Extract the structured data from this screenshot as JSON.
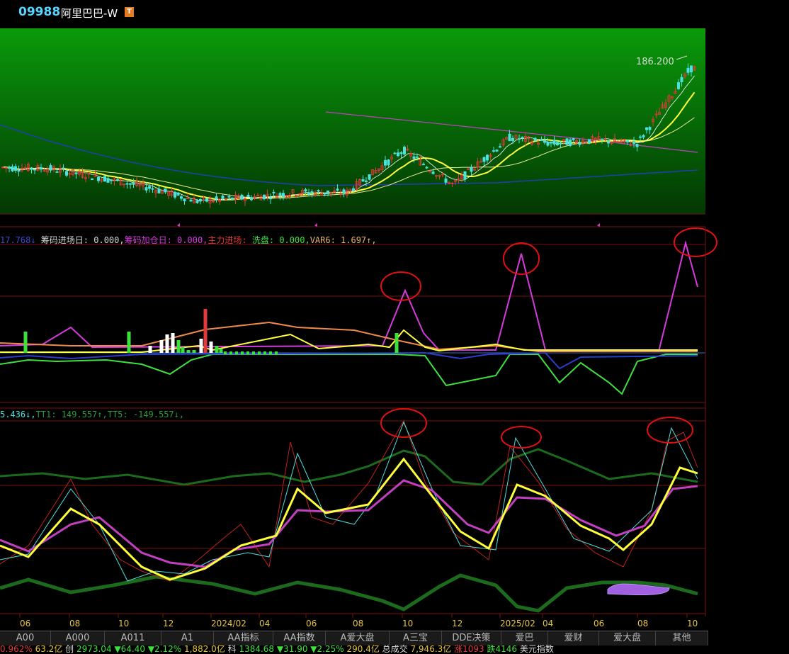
{
  "header": {
    "code": "09988",
    "name": "阿里巴巴-W",
    "badge": "T"
  },
  "price_label": "186.200",
  "legend1": [
    {
      "text": "17.768↓",
      "color": "#3b4ccf"
    },
    {
      "text": " 筹码进场日: 0.000,",
      "color": "#d8d8d8"
    },
    {
      "text": "筹码加仓日: 0.000,",
      "color": "#d63adf"
    },
    {
      "text": "主力进场:",
      "color": "#e23a3a"
    },
    {
      "text": " 洗盘: 0.000,",
      "color": "#3ee03e"
    },
    {
      "text": "VAR6: 1.697↑,",
      "color": "#e8b56a"
    }
  ],
  "legend2": [
    {
      "text": "5.436↓,",
      "color": "#4de0e0"
    },
    {
      "text": "TT1: 149.557↑,",
      "color": "#2f9a3a"
    },
    {
      "text": "TT5: -149.557↓,",
      "color": "#2f9a3a"
    }
  ],
  "dates": [
    "06",
    "08",
    "10",
    "12",
    "2024/02",
    "04",
    "06",
    "08",
    "10",
    "12",
    "2025/02",
    "04",
    "06",
    "08",
    "10"
  ],
  "tabs": [
    "A00",
    "A000",
    "A011",
    "A1",
    "AA指标",
    "AA指数",
    "A爱大盘",
    "A三宝",
    "DDE决策",
    "爱巴",
    "爱财",
    "爱大盘",
    "其他"
  ],
  "status": [
    {
      "text": "0.962% ",
      "color": "#e23a3a"
    },
    {
      "text": "63.2亿 ",
      "color": "#e4c637"
    },
    {
      "text": "创",
      "color": "#ddd"
    },
    {
      "text": " 2973.04 ",
      "color": "#3ee03e"
    },
    {
      "text": "▼64.40 ",
      "color": "#3ee03e"
    },
    {
      "text": "▼2.12% ",
      "color": "#3ee03e"
    },
    {
      "text": "1,882.0亿 ",
      "color": "#e4c637"
    },
    {
      "text": "科",
      "color": "#ddd"
    },
    {
      "text": " 1384.68 ",
      "color": "#3ee03e"
    },
    {
      "text": "▼31.90 ",
      "color": "#3ee03e"
    },
    {
      "text": "▼2.25% ",
      "color": "#3ee03e"
    },
    {
      "text": "290.4亿 ",
      "color": "#e4c637"
    },
    {
      "text": "总成交 ",
      "color": "#ddd"
    },
    {
      "text": "7,946.3亿 ",
      "color": "#e4c637"
    },
    {
      "text": "涨1093 ",
      "color": "#e23a3a"
    },
    {
      "text": "跌4146 ",
      "color": "#3ee03e"
    },
    {
      "text": "美元指数",
      "color": "#ddd"
    }
  ],
  "colors": {
    "up": "#e23a3a",
    "down": "#4de0e0",
    "ma5": "#ffffff",
    "ma10": "#ffff3a",
    "ma60": "#c040c0",
    "ma250": "#1f3fb0"
  },
  "chart_data": [
    {
      "type": "candlestick",
      "title": "09988 阿里巴巴-W",
      "x": [
        "2023/06",
        "2023/08",
        "2023/10",
        "2023/12",
        "2024/02",
        "2024/04",
        "2024/06",
        "2024/08",
        "2024/10",
        "2024/12",
        "2025/02",
        "2025/04",
        "2025/06",
        "2025/08",
        "2025/10"
      ],
      "series": [
        {
          "name": "close",
          "values": [
            96,
            95,
            88,
            80,
            69,
            72,
            76,
            76,
            110,
            82,
            120,
            115,
            118,
            115,
            175
          ]
        }
      ],
      "annotations": [
        "186.200"
      ]
    },
    {
      "type": "line",
      "legend": [
        "筹码进场日",
        "筹码加仓日",
        "主力进场",
        "洗盘",
        "VAR6"
      ],
      "x": [
        "2023/06",
        "2023/08",
        "2023/10",
        "2023/12",
        "2024/02",
        "2024/04",
        "2024/06",
        "2024/08",
        "2024/10",
        "2024/12",
        "2025/02",
        "2025/04",
        "2025/06",
        "2025/08",
        "2025/10"
      ],
      "series": [
        {
          "name": "筹码加仓日",
          "values": [
            0,
            5,
            0,
            0,
            0,
            0,
            0,
            0,
            18,
            0,
            28,
            0,
            0,
            0,
            30
          ]
        }
      ]
    },
    {
      "type": "line",
      "legend": [
        "TT1",
        "TT5"
      ],
      "x": [
        "2023/06",
        "2023/08",
        "2023/10",
        "2023/12",
        "2024/02",
        "2024/04",
        "2024/06",
        "2024/08",
        "2024/10",
        "2024/12",
        "2025/02",
        "2025/04",
        "2025/06",
        "2025/08",
        "2025/10"
      ],
      "series": [
        {
          "name": "TT1",
          "values": [
            149.557
          ]
        },
        {
          "name": "TT5",
          "values": [
            -149.557
          ]
        }
      ]
    }
  ]
}
